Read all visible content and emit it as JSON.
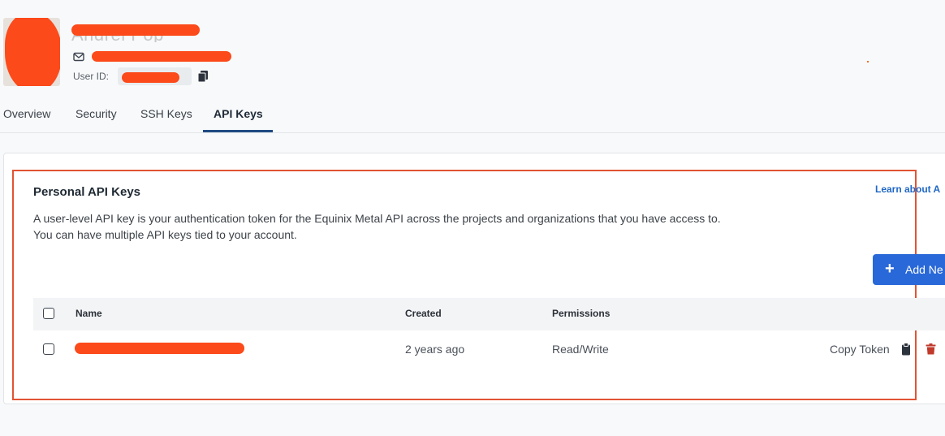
{
  "profile": {
    "name": "Andrei Pop",
    "user_id_label": "User ID:"
  },
  "tabs": [
    {
      "label": "Overview"
    },
    {
      "label": "Security"
    },
    {
      "label": "SSH Keys"
    },
    {
      "label": "API Keys",
      "active": true
    }
  ],
  "section": {
    "title": "Personal API Keys",
    "learn_link": "Learn about A",
    "description": "A user-level API key is your authentication token for the Equinix Metal API across the projects and organizations that you have access to. You can have multiple API keys tied to your account.",
    "add_button": "Add Ne"
  },
  "table": {
    "columns": [
      "Name",
      "Created",
      "Permissions"
    ],
    "rows": [
      {
        "created": "2 years ago",
        "permissions": "Read/Write",
        "copy_token": "Copy Token"
      }
    ]
  },
  "colors": {
    "accent": "#2968d8",
    "link": "#1f67c5",
    "delete": "#c0392b",
    "redaction": "#fc4a1a",
    "highlight": "#e25333"
  },
  "icons": [
    "mail-icon",
    "copy-icon",
    "plus-icon",
    "clipboard-icon",
    "trash-icon"
  ]
}
